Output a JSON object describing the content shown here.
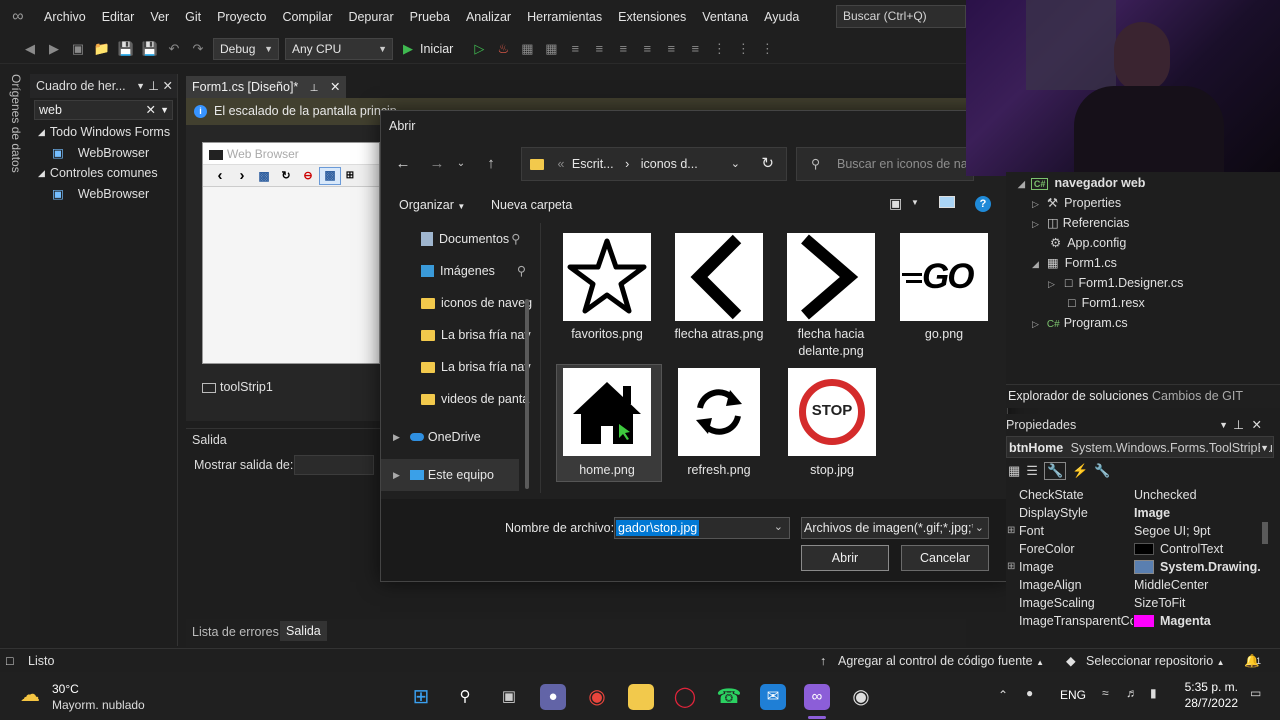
{
  "menubar": {
    "items": [
      "Archivo",
      "Editar",
      "Ver",
      "Git",
      "Proyecto",
      "Compilar",
      "Depurar",
      "Prueba",
      "Analizar",
      "Herramientas",
      "Extensiones",
      "Ventana",
      "Ayuda"
    ],
    "search": "Buscar (Ctrl+Q)"
  },
  "toolbar": {
    "config": "Debug",
    "platform": "Any CPU",
    "start": "Iniciar"
  },
  "left_strip": {
    "label": "Orígenes de datos"
  },
  "toolbox": {
    "title": "Cuadro de her...",
    "search_value": "web",
    "groups": [
      {
        "name": "Todo Windows Forms",
        "item": "WebBrowser"
      },
      {
        "name": "Controles comunes",
        "item": "WebBrowser"
      }
    ]
  },
  "editor": {
    "tab": "Form1.cs [Diseño]*",
    "infobar": "El escalado de la pantalla princip",
    "form_title": "Web Browser",
    "component": "toolStrip1"
  },
  "output": {
    "title": "Salida",
    "show_label": "Mostrar salida de:",
    "tabs": [
      "Lista de errores",
      "Salida"
    ]
  },
  "dialog": {
    "title": "Abrir",
    "breadcrumb": [
      "Escrit...",
      "iconos d..."
    ],
    "search_placeholder": "Buscar en iconos de nave",
    "organize": "Organizar",
    "new_folder": "Nueva carpeta",
    "sidebar": [
      "Documentos",
      "Imágenes",
      "iconos de naveg",
      "La brisa fría nav",
      "La brisa fría nav",
      "videos de panta",
      "OneDrive",
      "Este equipo"
    ],
    "files": [
      {
        "name": "favoritos.png"
      },
      {
        "name": "flecha atras.png"
      },
      {
        "name": "flecha hacia delante.png"
      },
      {
        "name": "go.png"
      },
      {
        "name": "home.png"
      },
      {
        "name": "refresh.png"
      },
      {
        "name": "stop.jpg"
      }
    ],
    "go_text": "GO",
    "stop_text": "STOP",
    "filename_label": "Nombre de archivo:",
    "filename_value": "gador\\stop.jpg",
    "filter": "Archivos de imagen(*.gif;*.jpg;*",
    "open": "Abrir",
    "cancel": "Cancelar"
  },
  "solution": {
    "project": "navegador web",
    "items": [
      "Properties",
      "Referencias",
      "App.config",
      "Form1.cs",
      "Form1.Designer.cs",
      "Form1.resx",
      "Program.cs"
    ],
    "tabs": [
      "Explorador de soluciones",
      "Cambios de GIT"
    ]
  },
  "properties": {
    "title": "Propiedades",
    "object": "btnHome",
    "object_type": "System.Windows.Forms.ToolStripBu",
    "rows": [
      {
        "name": "CheckState",
        "value": "Unchecked"
      },
      {
        "name": "DisplayStyle",
        "value": "Image"
      },
      {
        "name": "Font",
        "value": "Segoe UI; 9pt"
      },
      {
        "name": "ForeColor",
        "value": "ControlText"
      },
      {
        "name": "Image",
        "value": "System.Drawing."
      },
      {
        "name": "ImageAlign",
        "value": "MiddleCenter"
      },
      {
        "name": "ImageScaling",
        "value": "SizeToFit"
      },
      {
        "name": "ImageTransparentCol",
        "value": "Magenta"
      }
    ]
  },
  "statusbar": {
    "status": "Listo",
    "source_control": "Agregar al control de código fuente",
    "repo": "Seleccionar repositorio",
    "notifications": "1"
  },
  "taskbar": {
    "temp": "30°C",
    "weather": "Mayorm. nublado",
    "lang": "ENG",
    "time": "5:35 p. m.",
    "date": "28/7/2022"
  },
  "colors": {
    "accent": "#0078d4",
    "vs_purple": "#8c5ed8",
    "magenta": "#ff00ff"
  }
}
